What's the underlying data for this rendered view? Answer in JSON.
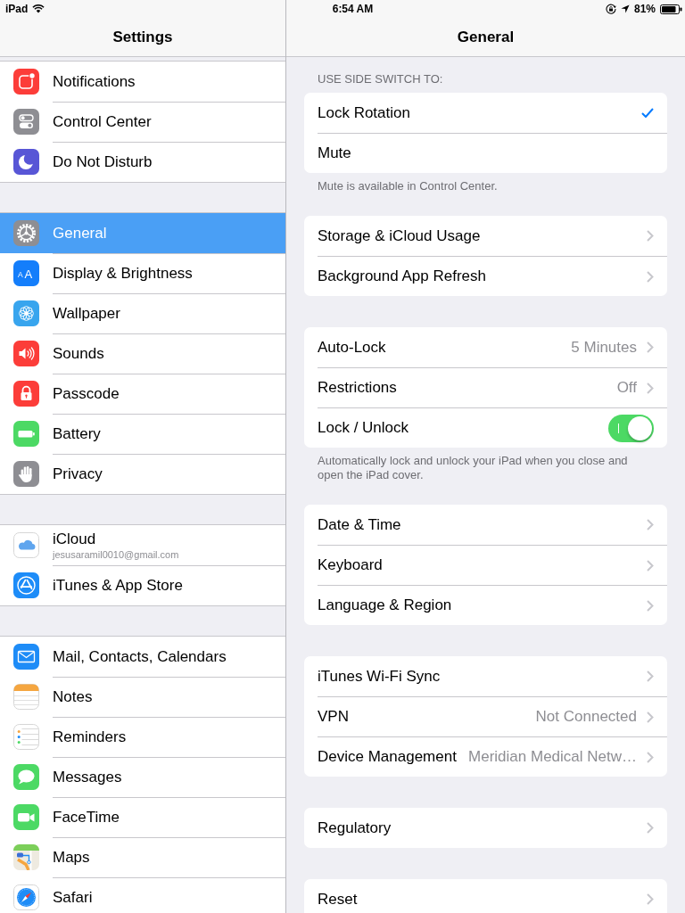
{
  "status_bar": {
    "device": "iPad",
    "time": "6:54 AM",
    "battery": "81%"
  },
  "sidebar": {
    "title": "Settings",
    "groups": [
      {
        "items": [
          {
            "label": "Notifications",
            "kind": "notifications",
            "selected": false
          },
          {
            "label": "Control Center",
            "kind": "control",
            "selected": false
          },
          {
            "label": "Do Not Disturb",
            "kind": "moon",
            "selected": false
          }
        ]
      },
      {
        "items": [
          {
            "label": "General",
            "kind": "gear",
            "selected": true
          },
          {
            "label": "Display & Brightness",
            "kind": "display",
            "icon_text": "AA",
            "selected": false
          },
          {
            "label": "Wallpaper",
            "kind": "wallpaper",
            "selected": false
          },
          {
            "label": "Sounds",
            "kind": "sounds",
            "selected": false
          },
          {
            "label": "Passcode",
            "kind": "passcode",
            "selected": false
          },
          {
            "label": "Battery",
            "kind": "battery",
            "selected": false
          },
          {
            "label": "Privacy",
            "kind": "privacy",
            "selected": false
          }
        ]
      },
      {
        "items": [
          {
            "label": "iCloud",
            "subtitle": "jesusaramil0010@gmail.com",
            "kind": "icloud",
            "selected": false
          },
          {
            "label": "iTunes & App Store",
            "kind": "appstore",
            "selected": false
          }
        ]
      },
      {
        "items": [
          {
            "label": "Mail, Contacts, Calendars",
            "kind": "mail",
            "selected": false
          },
          {
            "label": "Notes",
            "kind": "notes",
            "selected": false
          },
          {
            "label": "Reminders",
            "kind": "reminders",
            "selected": false
          },
          {
            "label": "Messages",
            "kind": "messages",
            "selected": false
          },
          {
            "label": "FaceTime",
            "kind": "facetime",
            "selected": false
          },
          {
            "label": "Maps",
            "kind": "maps",
            "selected": false
          },
          {
            "label": "Safari",
            "kind": "safari",
            "selected": false
          }
        ]
      }
    ]
  },
  "detail": {
    "title": "General",
    "groups": [
      {
        "header": "USE SIDE SWITCH TO:",
        "rows": [
          {
            "label": "Lock Rotation",
            "kind": "check",
            "checked": true
          },
          {
            "label": "Mute",
            "kind": "check",
            "checked": false
          }
        ],
        "footer": "Mute is available in Control Center."
      },
      {
        "rows": [
          {
            "label": "Storage & iCloud Usage",
            "kind": "link"
          },
          {
            "label": "Background App Refresh",
            "kind": "link"
          }
        ]
      },
      {
        "rows": [
          {
            "label": "Auto-Lock",
            "kind": "link",
            "value": "5 Minutes"
          },
          {
            "label": "Restrictions",
            "kind": "link",
            "value": "Off"
          },
          {
            "label": "Lock / Unlock",
            "kind": "switch",
            "on": true
          }
        ],
        "footer": "Automatically lock and unlock your iPad when you close and open the iPad cover."
      },
      {
        "rows": [
          {
            "label": "Date & Time",
            "kind": "link"
          },
          {
            "label": "Keyboard",
            "kind": "link"
          },
          {
            "label": "Language & Region",
            "kind": "link"
          }
        ]
      },
      {
        "rows": [
          {
            "label": "iTunes Wi-Fi Sync",
            "kind": "link"
          },
          {
            "label": "VPN",
            "kind": "link",
            "value": "Not Connected"
          },
          {
            "label": "Device Management",
            "kind": "link",
            "value": "Meridian Medical Netw…"
          }
        ]
      },
      {
        "rows": [
          {
            "label": "Regulatory",
            "kind": "link"
          }
        ]
      },
      {
        "rows": [
          {
            "label": "Reset",
            "kind": "link"
          }
        ]
      }
    ]
  }
}
